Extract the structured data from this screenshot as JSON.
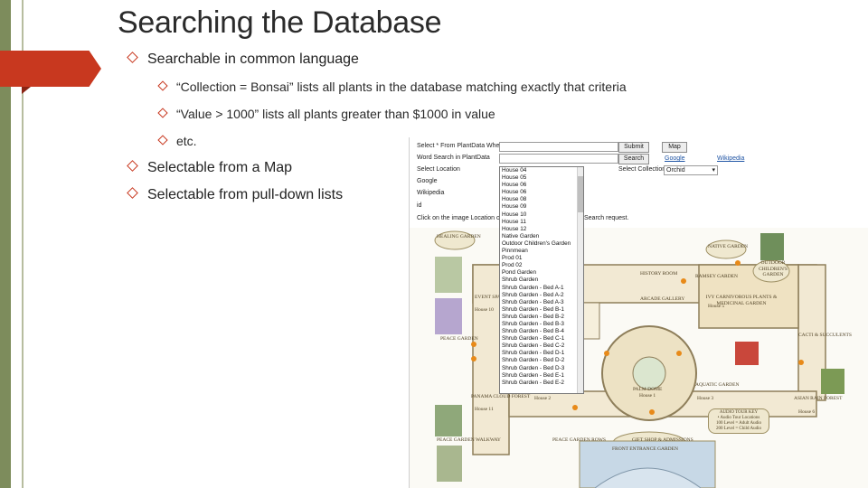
{
  "slide": {
    "title": "Searching the Database",
    "bullets": [
      {
        "text": "Searchable in common language"
      },
      {
        "text": "“Collection = Bonsai” lists all plants in the database matching exactly that criteria"
      },
      {
        "text": "“Value > 1000” lists all plants greater than $1000 in value"
      },
      {
        "text": "etc."
      },
      {
        "text": "Selectable from a Map"
      },
      {
        "text": "Selectable from pull-down lists"
      }
    ]
  },
  "form": {
    "select_label": "Select * From PlantData Where",
    "submit": "Submit",
    "map_btn": "Map",
    "word_search": "Word Search in PlantData",
    "search_btn": "Search",
    "select_location": "Select Location",
    "select_collection": "Select Collection",
    "collection_value": "Orchid",
    "google": "Google",
    "google_link": "Google",
    "wikipedia": "Wikipedia",
    "wikipedia_link": "Wikipedia",
    "id_label": "id",
    "click_note": "Click on the image Location or",
    "search_request": "Search request."
  },
  "location_options": [
    "House 04",
    "House 05",
    "House 06",
    "House 06",
    "House 08",
    "House 09",
    "House 10",
    "House 11",
    "House 12",
    "Native Garden",
    "Outdoor Children's Garden",
    "Pinnmean",
    "Prod 01",
    "Prod 02",
    "Pond Garden",
    "Shrub Garden",
    "Shrub Garden - Bed A-1",
    "Shrub Garden - Bed A-2",
    "Shrub Garden - Bed A-3",
    "Shrub Garden - Bed B-1",
    "Shrub Garden - Bed B-2",
    "Shrub Garden - Bed B-3",
    "Shrub Garden - Bed B-4",
    "Shrub Garden - Bed C-1",
    "Shrub Garden - Bed C-2",
    "Shrub Garden - Bed D-1",
    "Shrub Garden - Bed D-2",
    "Shrub Garden - Bed D-3",
    "Shrub Garden - Bed E-1",
    "Shrub Garden - Bed E-2"
  ],
  "map": {
    "healing_garden": "HEALING GARDEN",
    "native_garden": "NATIVE GARDEN",
    "outdoor_childrens": "OUTDOOR CHILDREN'S GARDEN",
    "history_room": "HISTORY ROOM",
    "ramsey_garden": "RAMSEY GARDEN",
    "ivy_carnivorous": "IVY CARNIVOROUS PLANTS & MEDICINAL GARDEN",
    "arcade_gallery": "ARCADE GALLERY",
    "event_space": "EVENT SPACE",
    "house_10": "House 10",
    "peace_garden": "PEACE GARDEN",
    "palm_dome": "PALM DOME",
    "house_1": "House 1",
    "house_2": "House 2",
    "house_3": "House 3",
    "house_5": "House 5",
    "house_6": "House 6",
    "house_11": "House 11",
    "aquatic_garden": "AQUATIC GARDEN",
    "asian_rain_forest": "ASIAN RAIN FOREST",
    "panama_cloud_forest": "PANAMA CLOUD FOREST",
    "cactii_succulents": "CACTI & SUCCULENTS",
    "gift_shop": "GIFT SHOP & ADMISSIONS",
    "peace_garden_walkway": "PEACE GARDEN WALKWAY",
    "peace_garden_rows": "PEACE GARDEN ROWS",
    "front_entrance": "FRONT ENTRANCE GARDEN",
    "audio_tour": "AUDIO TOUR KEY",
    "audio_line1": "• Audio Tour Locations",
    "audio_line2": "100 Level = Adult Audio",
    "audio_line3": "200 Level = Child Audio"
  },
  "colors": {
    "accent": "#c8381f",
    "rail": "#7d8c5c",
    "map_fill": "#f2e9d3",
    "map_border": "#8e7e5a",
    "marker": "#e88a19"
  }
}
